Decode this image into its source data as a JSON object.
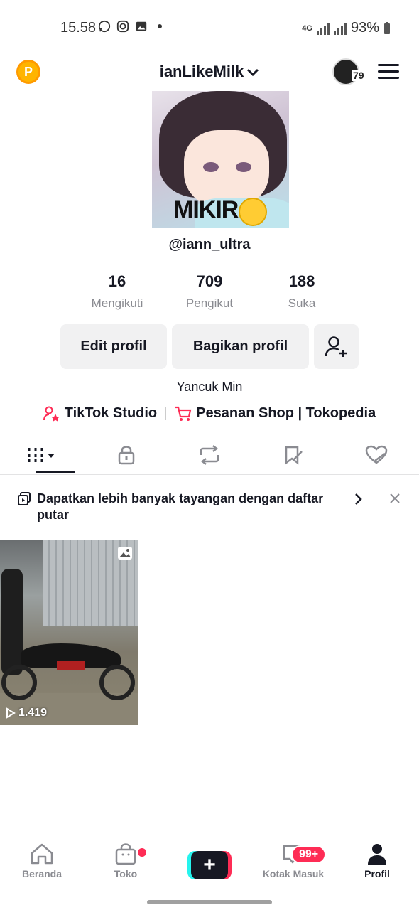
{
  "status_bar": {
    "time": "15.58",
    "network": "4G",
    "battery": "93%"
  },
  "header": {
    "username": "ianLikeMilk",
    "badge_count": "79"
  },
  "profile": {
    "avatar_caption": "MIKIR",
    "handle": "@iann_ultra",
    "bio": "Yancuk Min"
  },
  "stats": [
    {
      "value": "16",
      "label": "Mengikuti"
    },
    {
      "value": "709",
      "label": "Pengikut"
    },
    {
      "value": "188",
      "label": "Suka"
    }
  ],
  "buttons": {
    "edit": "Edit profil",
    "share": "Bagikan profil"
  },
  "links": {
    "studio": "TikTok Studio",
    "shop": "Pesanan Shop | Tokopedia"
  },
  "banner": {
    "text": "Dapatkan lebih banyak tayangan dengan daftar putar"
  },
  "videos": [
    {
      "views": "1.419"
    }
  ],
  "nav": {
    "home": "Beranda",
    "shop": "Toko",
    "inbox": "Kotak Masuk",
    "inbox_badge": "99+",
    "profile": "Profil"
  },
  "colors": {
    "accent": "#fe2c55",
    "secondary_accent": "#25f4ee",
    "text": "#161823",
    "muted": "#8a8b91"
  }
}
